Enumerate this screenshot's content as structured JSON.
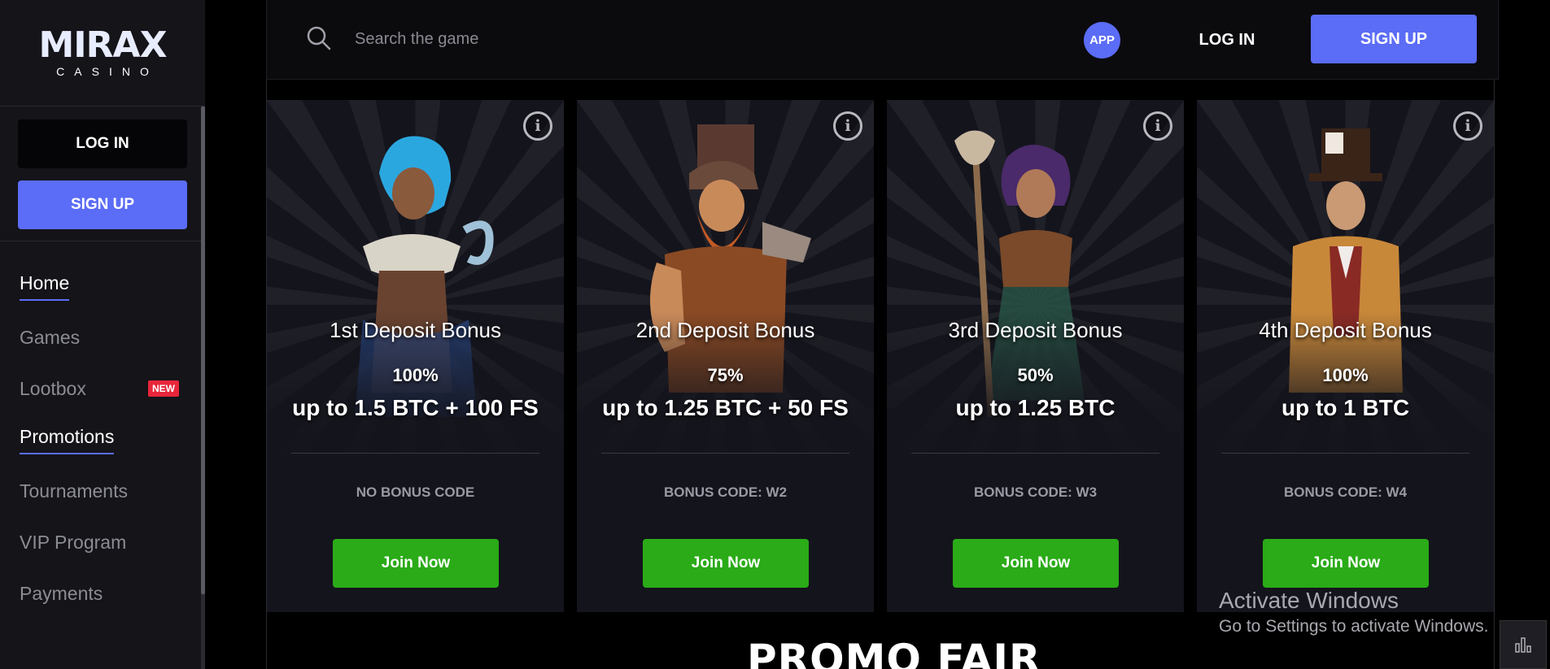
{
  "brand": {
    "name": "MIRAX",
    "sub": "CASINO"
  },
  "sidebar": {
    "login_label": "LOG IN",
    "signup_label": "SIGN UP",
    "nav": [
      {
        "label": "Home",
        "active": true
      },
      {
        "label": "Games",
        "active": false
      },
      {
        "label": "Lootbox",
        "active": false,
        "badge": "NEW"
      },
      {
        "label": "Promotions",
        "active": true
      },
      {
        "label": "Tournaments",
        "active": false
      },
      {
        "label": "VIP Program",
        "active": false
      },
      {
        "label": "Payments",
        "active": false
      }
    ]
  },
  "header": {
    "search_placeholder": "Search the game",
    "app_label": "APP",
    "login_label": "LOG IN",
    "signup_label": "SIGN UP"
  },
  "cards": [
    {
      "title": "1st Deposit Bonus",
      "percent": "100%",
      "amount": "up to 1.5 BTC + 100 FS",
      "code": "NO BONUS CODE",
      "button": "Join Now",
      "char": "pirate-woman"
    },
    {
      "title": "2nd Deposit Bonus",
      "percent": "75%",
      "amount": "up to 1.25 BTC + 50 FS",
      "code": "BONUS CODE: W2",
      "button": "Join Now",
      "char": "bearded-worker"
    },
    {
      "title": "3rd Deposit Bonus",
      "percent": "50%",
      "amount": "up to 1.25 BTC",
      "code": "BONUS CODE: W3",
      "button": "Join Now",
      "char": "shaman-woman"
    },
    {
      "title": "4th Deposit Bonus",
      "percent": "100%",
      "amount": "up to 1 BTC",
      "code": "BONUS CODE: W4",
      "button": "Join Now",
      "char": "top-hat-man"
    }
  ],
  "section_heading": "PROMO FAIR",
  "windows_watermark": {
    "line1": "Activate Windows",
    "line2": "Go to Settings to activate Windows."
  },
  "colors": {
    "accent": "#5b6cf6",
    "join": "#2aab17",
    "badge": "#e8263a"
  }
}
